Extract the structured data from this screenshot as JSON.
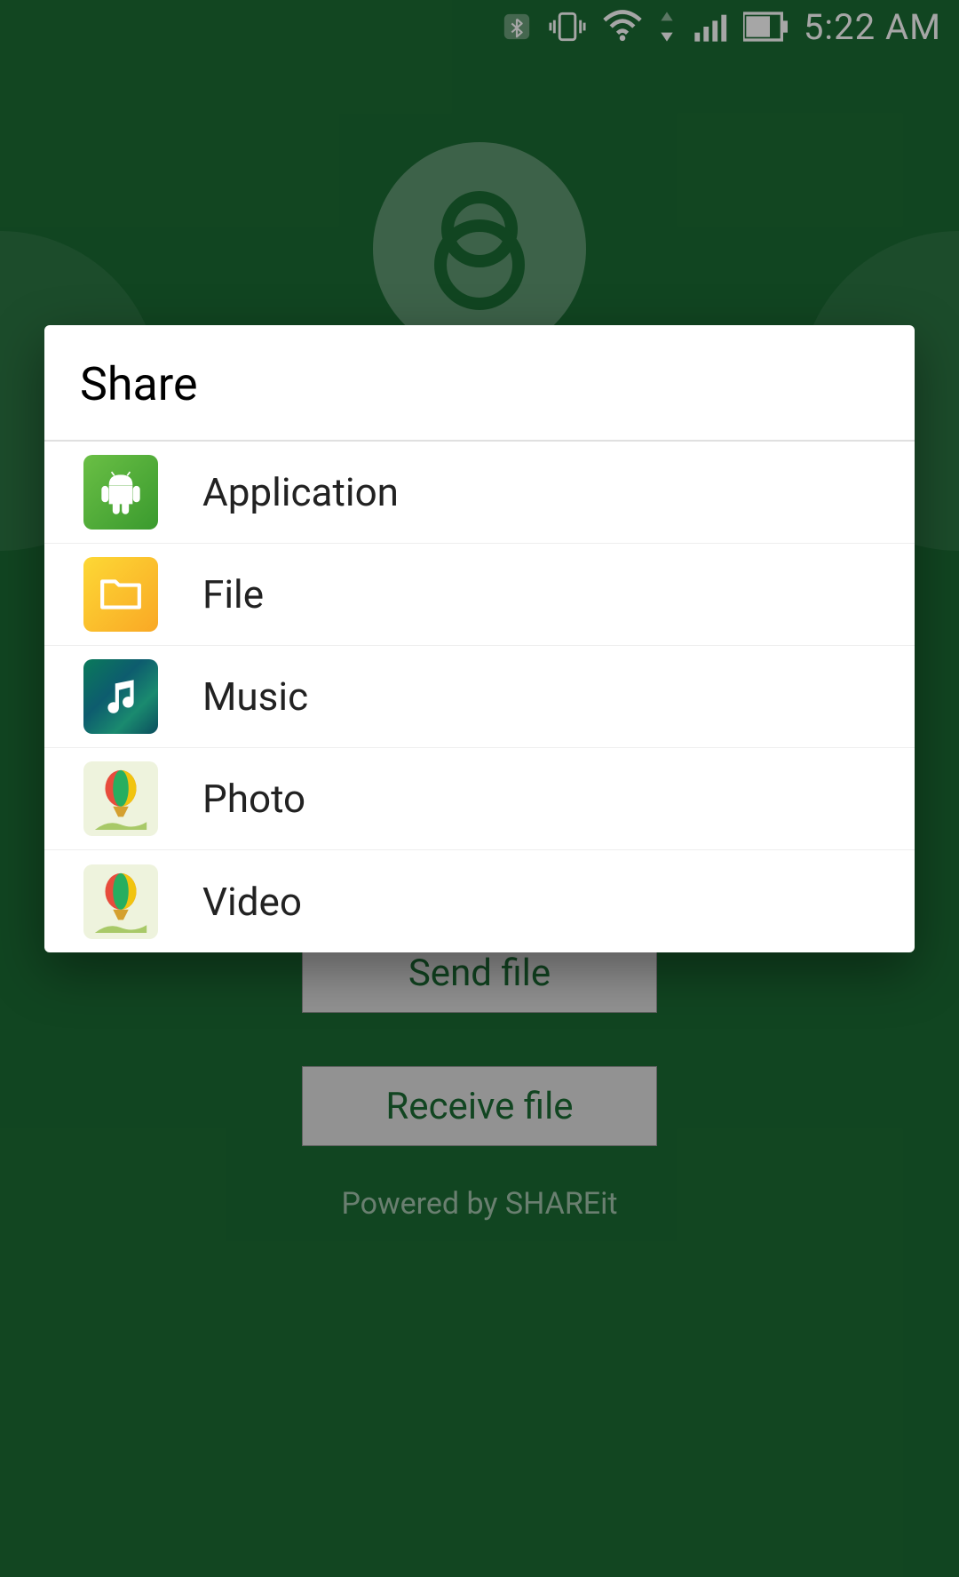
{
  "status_bar": {
    "time": "5:22 AM"
  },
  "background": {
    "send_label": "Send file",
    "receive_label": "Receive file",
    "powered_label": "Powered by SHAREit"
  },
  "dialog": {
    "title": "Share",
    "items": [
      {
        "label": "Application",
        "icon": "android-icon"
      },
      {
        "label": "File",
        "icon": "folder-icon"
      },
      {
        "label": "Music",
        "icon": "music-icon"
      },
      {
        "label": "Photo",
        "icon": "balloon-icon"
      },
      {
        "label": "Video",
        "icon": "balloon-icon"
      }
    ]
  }
}
